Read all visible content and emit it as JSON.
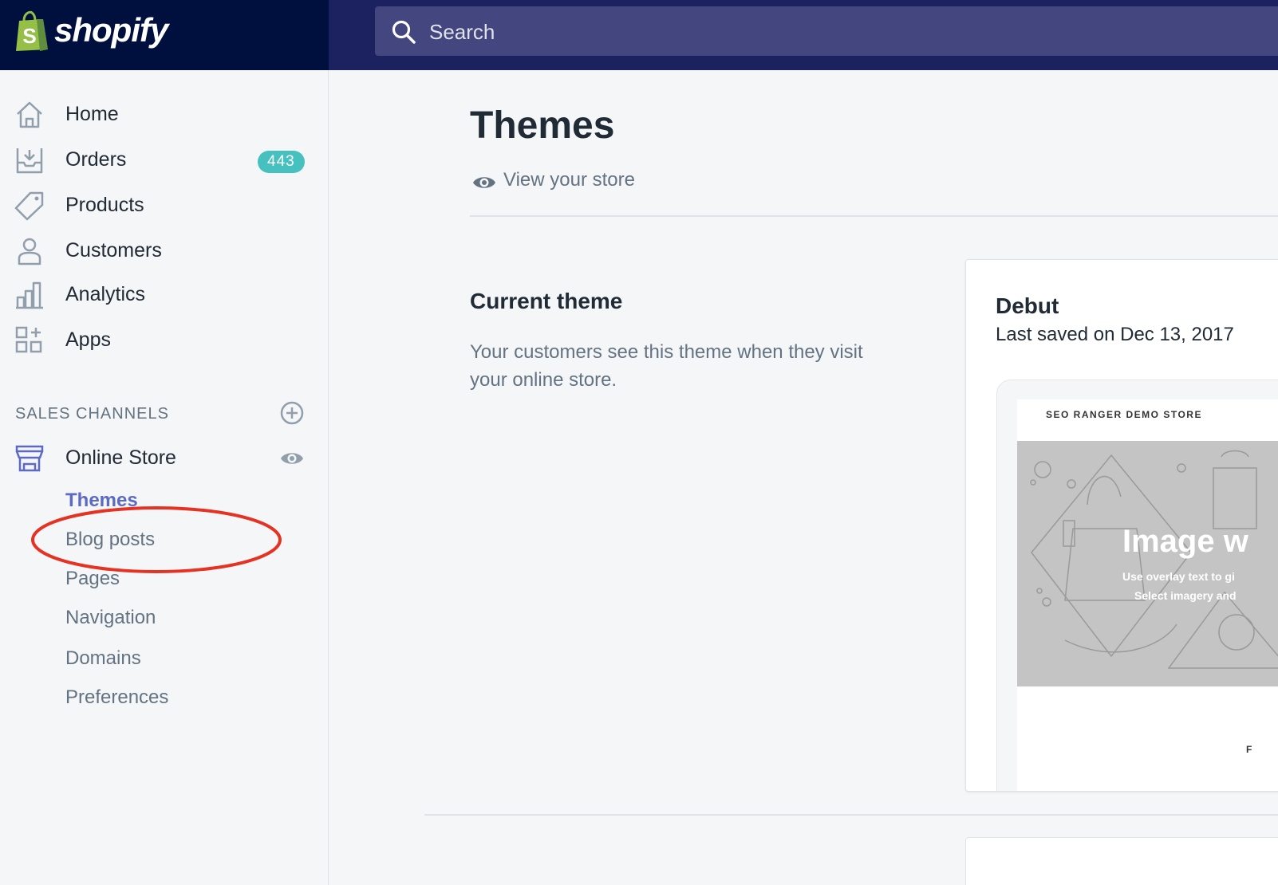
{
  "colors": {
    "topbar": "#1c2260",
    "logo_bg": "#00103e",
    "accent": "#5c6ac4",
    "badge": "#47c1bf",
    "annotation": "#e53222"
  },
  "brand": {
    "name": "shopify",
    "logo_letter": "S",
    "icon": "shopify-bag-icon"
  },
  "search": {
    "placeholder": "Search",
    "icon": "search-icon"
  },
  "sidebar": {
    "items": [
      {
        "label": "Home",
        "icon": "home-icon"
      },
      {
        "label": "Orders",
        "icon": "orders-icon",
        "badge": "443"
      },
      {
        "label": "Products",
        "icon": "tag-icon"
      },
      {
        "label": "Customers",
        "icon": "person-icon"
      },
      {
        "label": "Analytics",
        "icon": "bar-chart-icon"
      },
      {
        "label": "Apps",
        "icon": "apps-icon"
      }
    ],
    "sales_channels_title": "SALES CHANNELS",
    "online_store": {
      "label": "Online Store",
      "icon": "store-icon"
    },
    "sub_items": [
      "Themes",
      "Blog posts",
      "Pages",
      "Navigation",
      "Domains",
      "Preferences"
    ],
    "active_sub_item": "Themes",
    "highlighted_sub_item": "Blog posts"
  },
  "main": {
    "title": "Themes",
    "view_store": "View your store",
    "current_theme": {
      "heading": "Current theme",
      "description": "Your customers see this theme when they visit your online store."
    }
  },
  "theme_card": {
    "name": "Debut",
    "last_saved": "Last saved on Dec 13, 2017",
    "preview": {
      "store_name": "SEO RANGER DEMO STORE",
      "hero_title": "Image w",
      "hero_line1": "Use overlay text to gi",
      "hero_line2": "Select imagery and",
      "tail_text": "F"
    }
  }
}
